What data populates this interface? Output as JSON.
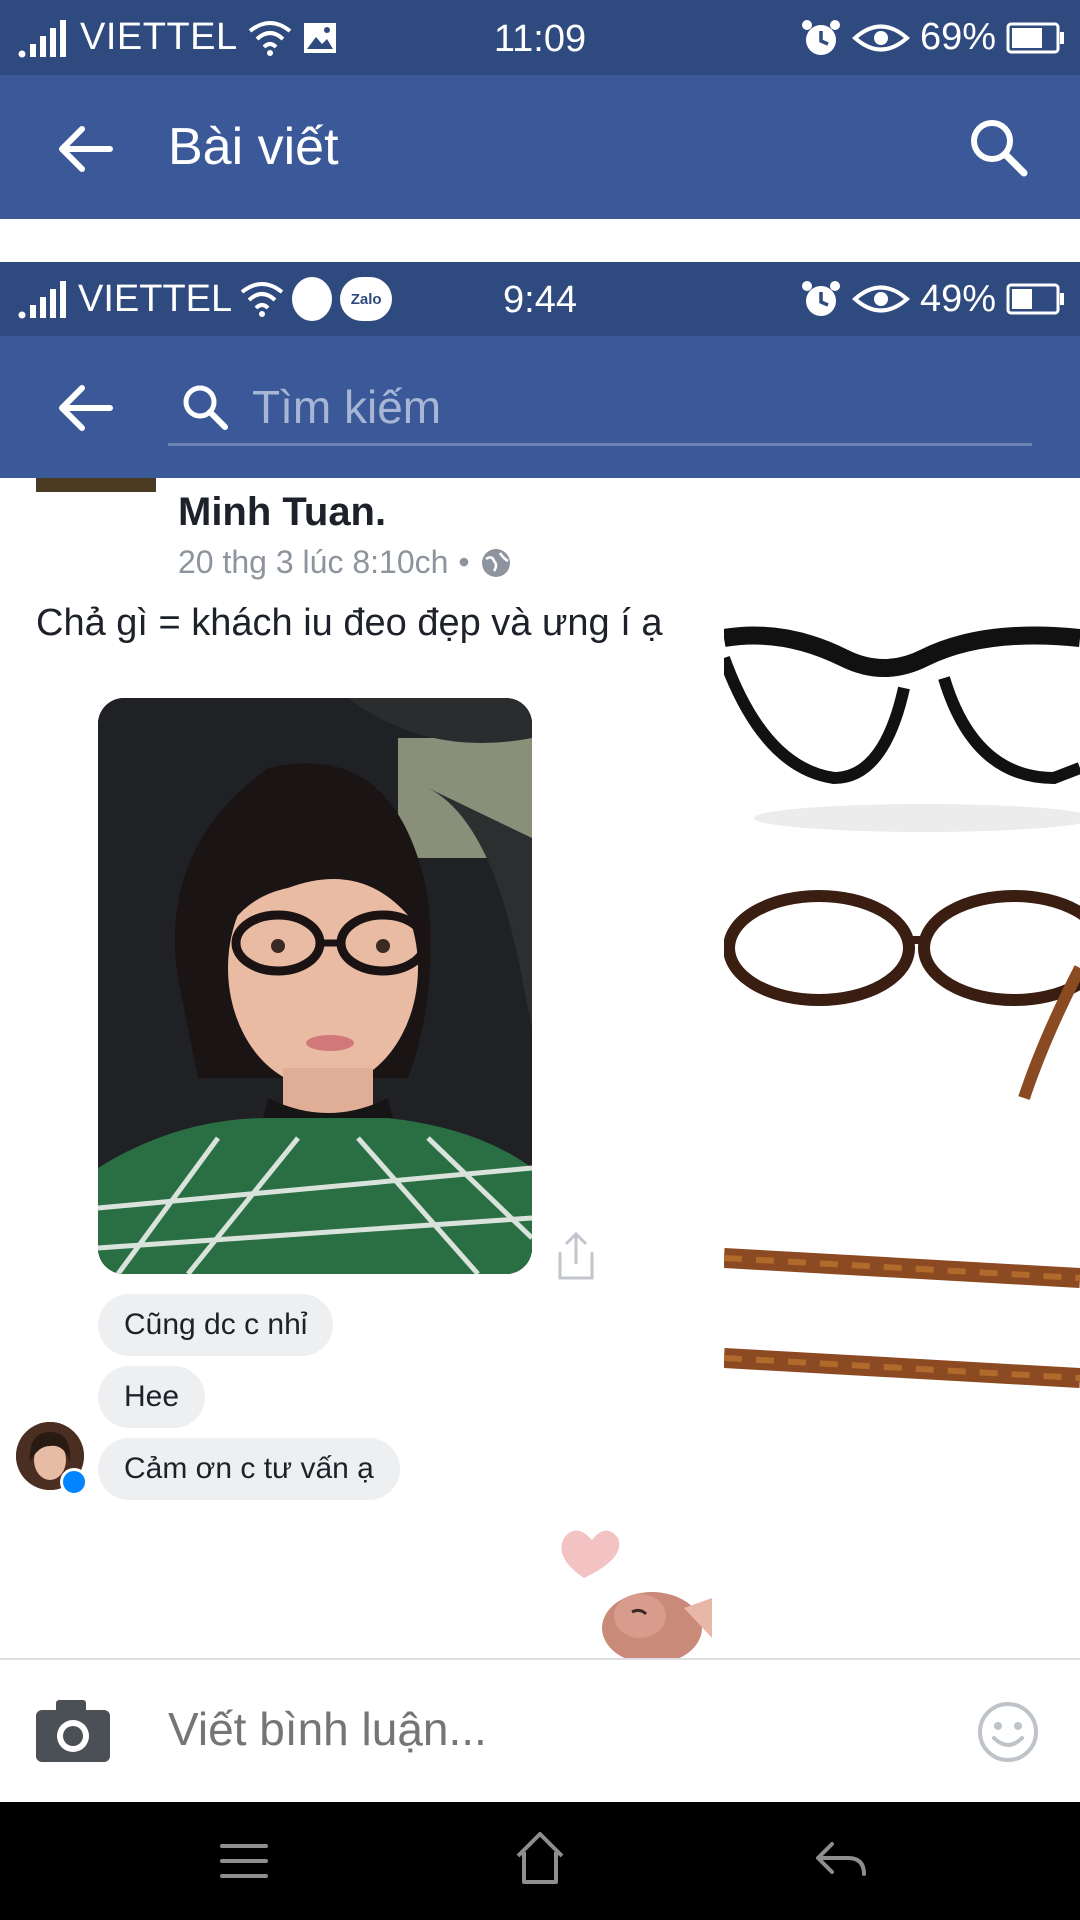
{
  "status_bar": {
    "carrier": "VIETTEL",
    "time": "11:09",
    "battery": "69%"
  },
  "app_bar": {
    "title": "Bài viết"
  },
  "embedded_screenshot": {
    "status_bar": {
      "carrier": "VIETTEL",
      "zalo_label": "Zalo",
      "time": "9:44",
      "battery": "49%"
    },
    "search": {
      "placeholder": "Tìm kiếm"
    },
    "post": {
      "author": "Minh Tuan.",
      "timestamp": "20 thg 3 lúc 8:10ch",
      "separator": "•",
      "text": "Chả gì = khách iu đeo đẹp và ưng í ạ"
    },
    "messages": [
      "Cũng dc c nhỉ",
      "Hee",
      "Cảm ơn c tư vấn ạ"
    ]
  },
  "comment_bar": {
    "placeholder": "Viết bình luận..."
  },
  "colors": {
    "facebook_blue": "#3b5998",
    "status_blue": "#2f4a7f",
    "messenger_blue": "#0084ff"
  }
}
